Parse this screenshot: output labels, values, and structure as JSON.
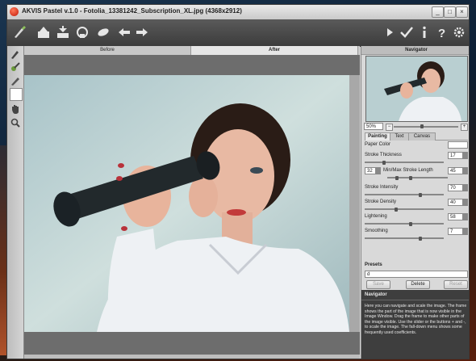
{
  "window": {
    "title": "AKVIS Pastel v.1.0 - Fotolia_13381242_Subscription_XL.jpg (4368x2912)",
    "controls": [
      "_",
      "□",
      "×"
    ]
  },
  "toolbar": {
    "left_icons": [
      "brush-icon",
      "open-image-icon",
      "save-image-icon",
      "print-icon",
      "share-icon",
      "undo-icon",
      "redo-icon"
    ],
    "right_icons": [
      "run-icon",
      "apply-icon",
      "about-icon",
      "help-icon",
      "settings-icon"
    ]
  },
  "view_tabs": {
    "before": "Before",
    "after": "After",
    "active": "After"
  },
  "navigator": {
    "title": "Navigator",
    "zoom": "50%"
  },
  "param_tabs": {
    "painting": "Painting",
    "text": "Text",
    "canvas": "Canvas",
    "active": "Painting"
  },
  "params": {
    "paper_color": "Paper Color",
    "stroke_thickness": {
      "label": "Stroke Thickness",
      "value": "17",
      "fraction": 0.24
    },
    "min_max_stroke": {
      "label": "Min/Max Stroke Length",
      "min": "32",
      "max": "45",
      "min_fraction": 0.32,
      "max_fraction": 0.45
    },
    "stroke_intensity": {
      "label": "Stroke Intensity",
      "value": "70",
      "fraction": 0.7
    },
    "stroke_density": {
      "label": "Stroke Density",
      "value": "40",
      "fraction": 0.4
    },
    "lightening": {
      "label": "Lightening",
      "value": "58",
      "fraction": 0.58
    },
    "smoothing": {
      "label": "Smoothing",
      "value": "7",
      "fraction": 0.7
    }
  },
  "presets": {
    "title": "Presets",
    "selected": "d",
    "save": "Save",
    "delete": "Delete",
    "reset": "Reset"
  },
  "help": {
    "title": "Navigator",
    "text": "Here you can navigate and scale the image. The frame shows the part of the image that is now visible in the Image Window. Drag the frame to make other parts of the image visible. Use the slider or the buttons + and -, to scale the image. The fall-down menu shows some frequently used coefficients."
  }
}
